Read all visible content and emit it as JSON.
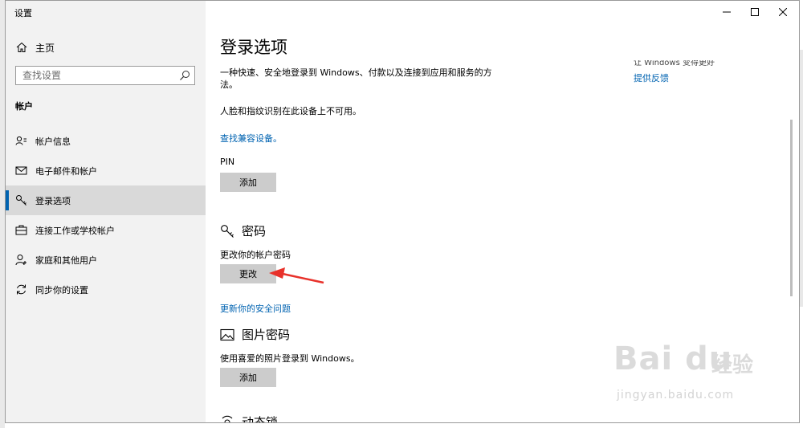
{
  "window": {
    "title": "设置"
  },
  "sidebar": {
    "home_label": "主页",
    "search_placeholder": "查找设置",
    "section_label": "帐户",
    "items": [
      {
        "label": "帐户信息",
        "icon": "person-card-icon",
        "active": false
      },
      {
        "label": "电子邮件和帐户",
        "icon": "mail-icon",
        "active": false
      },
      {
        "label": "登录选项",
        "icon": "key-icon",
        "active": true
      },
      {
        "label": "连接工作或学校帐户",
        "icon": "briefcase-icon",
        "active": false
      },
      {
        "label": "家庭和其他用户",
        "icon": "person-add-icon",
        "active": false
      },
      {
        "label": "同步你的设置",
        "icon": "sync-icon",
        "active": false
      }
    ]
  },
  "main": {
    "title": "登录选项",
    "description": "一种快速、安全地登录到 Windows、付款以及连接到应用和服务的方法。",
    "face_unavailable": "人脸和指纹识别在此设备上不可用。",
    "find_devices_link": "查找兼容设备。",
    "pin": {
      "label": "PIN",
      "button": "添加"
    },
    "password": {
      "heading": "密码",
      "subtext": "更改你的帐户密码",
      "button": "更改",
      "security_link": "更新你的安全问题"
    },
    "picture_password": {
      "heading": "图片密码",
      "subtext": "使用喜爱的照片登录到 Windows。",
      "button": "添加"
    },
    "dynamic_lock_heading": "动态锁"
  },
  "right_pane": {
    "cut_text": "让 Windows 变得更好",
    "feedback_link": "提供反馈"
  },
  "watermark": {
    "brand": "Bai du",
    "cn": "经验",
    "url": "jingyan.baidu.com"
  },
  "colors": {
    "accent": "#0063b1",
    "sidebar_bg": "#f2f2f2",
    "button_bg": "#cccccc",
    "arrow": "#e8312a"
  }
}
